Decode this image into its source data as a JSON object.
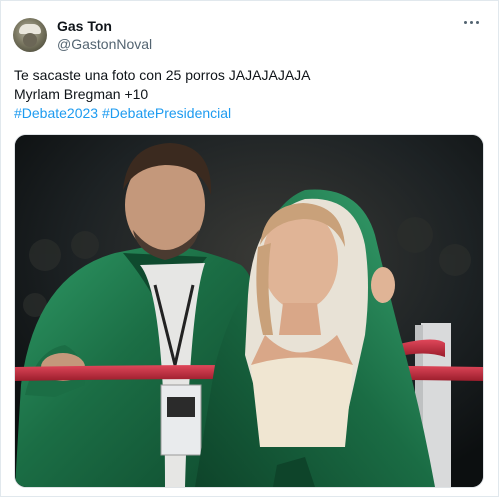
{
  "tweet": {
    "author_name": "Gas Ton",
    "author_handle": "@GastonNoval",
    "more_icon": "more-horizontal-icon",
    "text_line_1": "Te sacaste una foto con 25 porros JAJAJAJAJA",
    "text_line_2": "Myrlam Bregman +10",
    "hashtag_1": "#Debate2023",
    "hashtag_2": "#DebatePresidencial"
  },
  "colors": {
    "name": "#0f1419",
    "secondary": "#536471",
    "link": "#1d9bf0",
    "jacket_green": "#1c7a4e",
    "rope_red": "#c3283a"
  }
}
